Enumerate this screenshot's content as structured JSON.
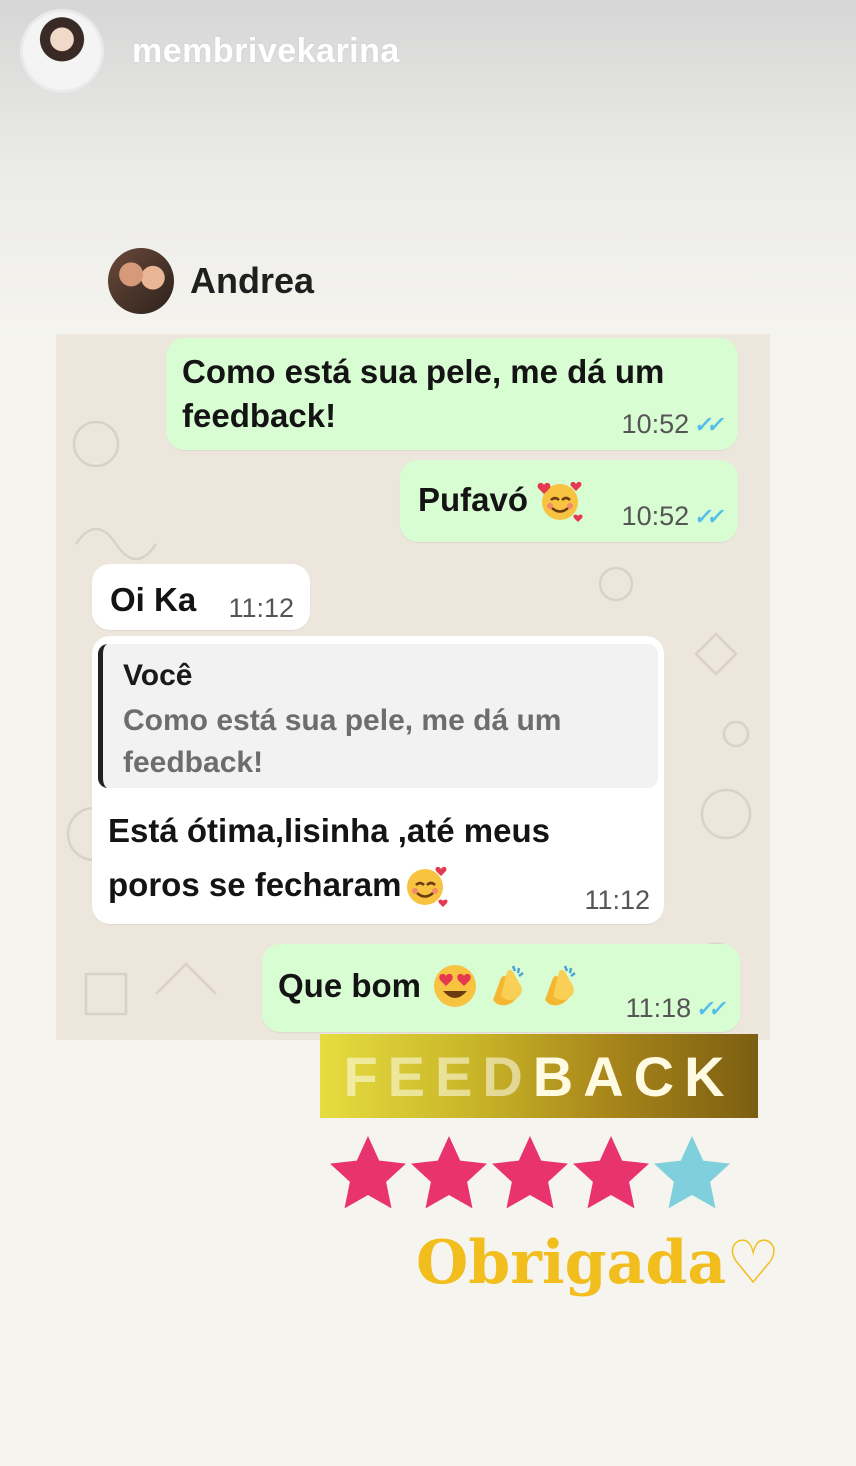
{
  "story": {
    "username": "membrivekarina"
  },
  "chat": {
    "contact_name": "Andrea",
    "messages": [
      {
        "direction": "out",
        "text_line1": "Como está sua pele, me dá um",
        "text_line2": "feedback!",
        "time": "10:52"
      },
      {
        "direction": "out",
        "text": "Pufavó",
        "emoji": "smiling-face-with-hearts",
        "time": "10:52"
      },
      {
        "direction": "in",
        "text": "Oi Ka",
        "time": "11:12"
      },
      {
        "direction": "in",
        "quote_author": "Você",
        "quote_line1": "Como está sua pele, me dá um",
        "quote_line2": "feedback!",
        "text_line1": "Está ótima,lisinha ,até meus",
        "text_line2": "poros se fecharam",
        "emoji": "smiling-face-with-hearts",
        "time": "11:12"
      },
      {
        "direction": "out",
        "text": "Que bom",
        "emojis": [
          "heart-eyes",
          "clapping-hands",
          "clapping-hands"
        ],
        "time": "11:18"
      }
    ]
  },
  "overlay": {
    "banner_text_light": "FEED",
    "banner_text_bold": "BACK",
    "rating": {
      "filled": 4,
      "total": 5
    },
    "thanks": "Obrigada♡"
  },
  "colors": {
    "outgoing_bubble": "#d9fdd3",
    "incoming_bubble": "#ffffff",
    "read_ticks": "#53bdeb",
    "star_filled": "#e8336e",
    "star_empty": "#7fd0dc",
    "thanks_text": "#f1be1d"
  }
}
